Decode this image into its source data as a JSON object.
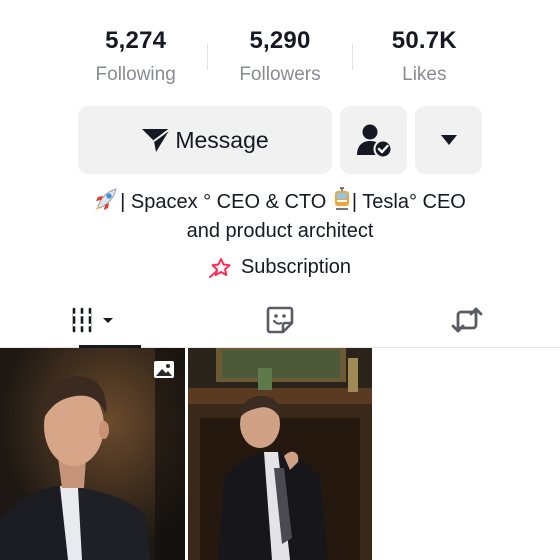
{
  "stats": [
    {
      "value": "5,274",
      "label": "Following"
    },
    {
      "value": "5,290",
      "label": "Followers"
    },
    {
      "value": "50.7K",
      "label": "Likes"
    }
  ],
  "actions": {
    "message_label": "Message",
    "friend_icon": "user-check-icon",
    "more_icon": "caret-down-icon"
  },
  "bio": {
    "line1_pre": "| Spacex ° CEO & CTO ",
    "line1_post": "| Tesla° CEO",
    "line2": "and product architect",
    "emoji1": "rocket",
    "emoji2": "tram"
  },
  "subscription": {
    "label": "Subscription",
    "accent": "#fe2c55"
  },
  "tabs": [
    {
      "name": "videos",
      "icon": "grid-bars-icon",
      "active": true
    },
    {
      "name": "stickers",
      "icon": "sticker-icon",
      "active": false
    },
    {
      "name": "reposts",
      "icon": "repost-icon",
      "active": false
    }
  ],
  "grid": {
    "items": [
      {
        "type": "photo",
        "badge": "photo-icon"
      },
      {
        "type": "video"
      },
      {
        "type": "empty"
      }
    ]
  }
}
